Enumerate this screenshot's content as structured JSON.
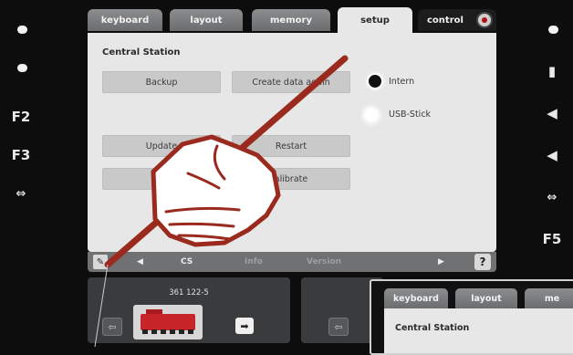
{
  "side_left": {
    "items": [
      {
        "type": "light",
        "icon": "light-icon"
      },
      {
        "type": "light",
        "icon": "light-icon"
      },
      {
        "type": "label",
        "label": "F2"
      },
      {
        "type": "label",
        "label": "F3"
      },
      {
        "type": "car",
        "icon": "car-icon"
      }
    ]
  },
  "side_right": {
    "items": [
      {
        "icon": "light-icon"
      },
      {
        "icon": "horn-icon"
      },
      {
        "icon": "speaker-icon"
      },
      {
        "icon": "speaker-icon"
      },
      {
        "icon": "car-icon"
      },
      {
        "label": "F5"
      }
    ]
  },
  "tabs": {
    "keyboard": "keyboard",
    "layout": "layout",
    "memory": "memory",
    "setup": "setup",
    "control": "control"
  },
  "panel": {
    "title": "Central Station",
    "buttons": {
      "backup": "Backup",
      "create_data": "Create data again",
      "update": "Update",
      "restart": "Restart",
      "s": "S",
      "calibrate": "alibrate"
    },
    "radio": {
      "intern": "Intern",
      "usb": "USB-Stick",
      "selected": "intern"
    }
  },
  "bottombar": {
    "left_arrow": "◀",
    "cs": "CS",
    "info": "Info",
    "version": "Version",
    "right_arrow": "▶",
    "help": "?"
  },
  "loco1": {
    "number": "361 122-5"
  },
  "mini": {
    "tabs": {
      "keyboard": "keyboard",
      "layout": "layout",
      "more": "me"
    },
    "title": "Central Station"
  },
  "colors": {
    "panel_bg": "#e7e7e7",
    "tab_bg": "#7b7d7f",
    "hand_stroke": "#9b2a1e"
  }
}
